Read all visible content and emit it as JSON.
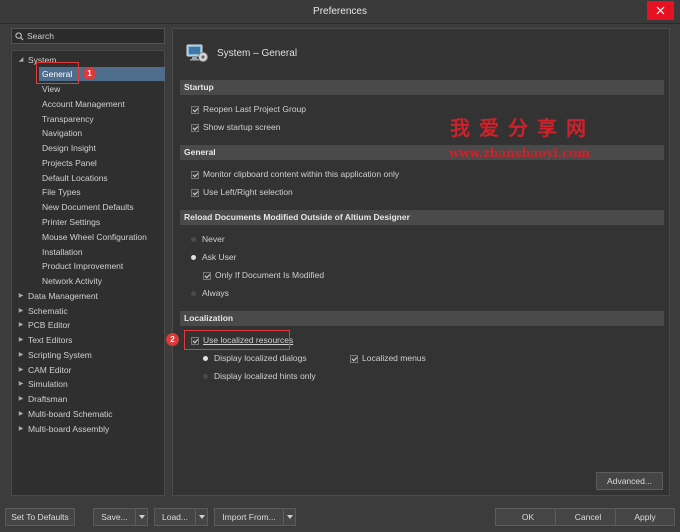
{
  "window": {
    "title": "Preferences"
  },
  "search": {
    "placeholder": "Search"
  },
  "tree": [
    {
      "label": "System",
      "expanded": true,
      "level": 0
    },
    {
      "label": "General",
      "level": 1,
      "selected": true
    },
    {
      "label": "View",
      "level": 1
    },
    {
      "label": "Account Management",
      "level": 1
    },
    {
      "label": "Transparency",
      "level": 1
    },
    {
      "label": "Navigation",
      "level": 1
    },
    {
      "label": "Design Insight",
      "level": 1
    },
    {
      "label": "Projects Panel",
      "level": 1
    },
    {
      "label": "Default Locations",
      "level": 1
    },
    {
      "label": "File Types",
      "level": 1
    },
    {
      "label": "New Document Defaults",
      "level": 1
    },
    {
      "label": "Printer Settings",
      "level": 1
    },
    {
      "label": "Mouse Wheel Configuration",
      "level": 1
    },
    {
      "label": "Installation",
      "level": 1
    },
    {
      "label": "Product Improvement",
      "level": 1
    },
    {
      "label": "Network Activity",
      "level": 1
    },
    {
      "label": "Data Management",
      "level": 0
    },
    {
      "label": "Schematic",
      "level": 0
    },
    {
      "label": "PCB Editor",
      "level": 0
    },
    {
      "label": "Text Editors",
      "level": 0
    },
    {
      "label": "Scripting System",
      "level": 0
    },
    {
      "label": "CAM Editor",
      "level": 0
    },
    {
      "label": "Simulation",
      "level": 0
    },
    {
      "label": "Draftsman",
      "level": 0
    },
    {
      "label": "Multi-board Schematic",
      "level": 0
    },
    {
      "label": "Multi-board Assembly",
      "level": 0
    }
  ],
  "panel": {
    "title": "System – General",
    "icon": "system-general-icon",
    "sections": {
      "startup": {
        "title": "Startup",
        "reopen": {
          "label": "Reopen Last Project Group",
          "checked": true
        },
        "splash": {
          "label": "Show startup screen",
          "checked": true
        }
      },
      "general": {
        "title": "General",
        "clipboard": {
          "label": "Monitor clipboard content within this application only",
          "checked": true
        },
        "leftright": {
          "label": "Use Left/Right selection",
          "checked": true
        }
      },
      "reload": {
        "title": "Reload Documents Modified Outside of Altium Designer",
        "never": {
          "label": "Never",
          "selected": false
        },
        "ask": {
          "label": "Ask User",
          "selected": true
        },
        "only_modified": {
          "label": "Only If Document Is Modified",
          "checked": true
        },
        "always": {
          "label": "Always",
          "selected": false
        }
      },
      "localization": {
        "title": "Localization",
        "use_localized": {
          "label": "Use localized resources",
          "checked": true
        },
        "dialogs": {
          "label": "Display localized dialogs",
          "selected": true
        },
        "menus": {
          "label": "Localized menus",
          "checked": true
        },
        "hints": {
          "label": "Display localized hints only",
          "selected": false
        }
      }
    },
    "advanced_label": "Advanced..."
  },
  "annotations": {
    "badge1": "1",
    "badge2": "2"
  },
  "watermark": {
    "title": "我爱分享网",
    "url": "www.zhanshaoyi.com"
  },
  "footer": {
    "set_defaults": "Set To Defaults",
    "save": "Save...",
    "load": "Load...",
    "import_from": "Import From...",
    "ok": "OK",
    "cancel": "Cancel",
    "apply": "Apply"
  },
  "colors": {
    "accent": "#4f6d8d",
    "annotation": "#e23a3a",
    "close": "#e81123",
    "watermark": "#d0202a"
  }
}
